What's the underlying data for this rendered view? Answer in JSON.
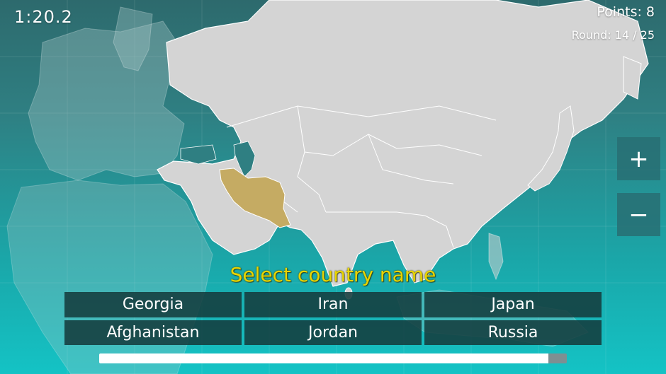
{
  "hud": {
    "timer": "1:20.2",
    "points": "Points: 8",
    "round": "Round: 14 / 25"
  },
  "zoom": {
    "zoom_in_icon": "plus-icon",
    "zoom_in_glyph": "+",
    "zoom_out_icon": "minus-icon",
    "zoom_out_glyph": "−"
  },
  "prompt": "Select country name",
  "answers": [
    "Georgia",
    "Iran",
    "Japan",
    "Afghanistan",
    "Jordan",
    "Russia"
  ],
  "progress": {
    "fraction": 0.96
  },
  "map": {
    "highlighted_country": "Iran"
  },
  "colors": {
    "land": "#d4d4d4",
    "land_border": "#ffffff",
    "highlight": "#c5ab63",
    "prompt": "#e8d400",
    "ocean_top": "#2d6a6d",
    "ocean_bottom": "#14c3c5",
    "button_bg": "#143c3e"
  }
}
